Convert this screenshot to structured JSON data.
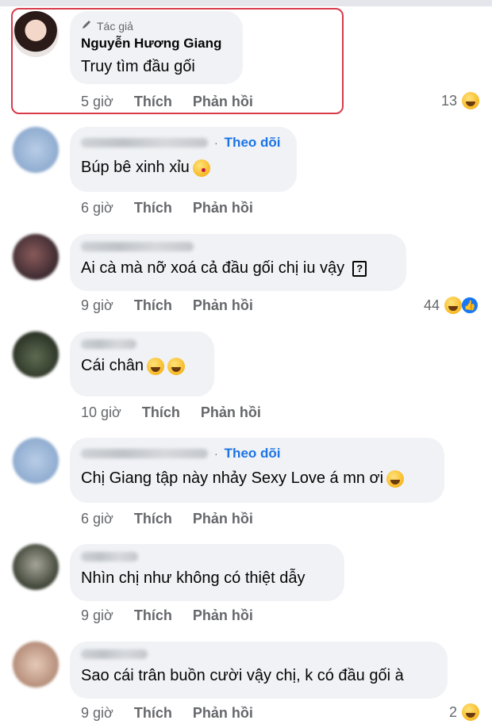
{
  "comments": [
    {
      "author_tag": "Tác giả",
      "name": "Nguyễn Hương Giang",
      "follow": "",
      "text": "Truy tìm đầu gối",
      "time": "5 giờ",
      "like": "Thích",
      "reply": "Phản hồi",
      "reaction_count": "13"
    },
    {
      "author_tag": "",
      "name": "",
      "follow": "Theo dõi",
      "text": "Búp bê xinh xỉu",
      "time": "6 giờ",
      "like": "Thích",
      "reply": "Phản hồi",
      "reaction_count": ""
    },
    {
      "author_tag": "",
      "name": "",
      "follow": "",
      "text": "Ai cà mà nỡ xoá cả đầu gối chị iu vậy",
      "time": "9 giờ",
      "like": "Thích",
      "reply": "Phản hồi",
      "reaction_count": "44"
    },
    {
      "author_tag": "",
      "name": "",
      "follow": "",
      "text": "Cái chân",
      "time": "10 giờ",
      "like": "Thích",
      "reply": "Phản hồi",
      "reaction_count": ""
    },
    {
      "author_tag": "",
      "name": "",
      "follow": "Theo dõi",
      "text": "Chị Giang tập này nhảy Sexy Love á mn ơi",
      "time": "6 giờ",
      "like": "Thích",
      "reply": "Phản hồi",
      "reaction_count": ""
    },
    {
      "author_tag": "",
      "name": "",
      "follow": "",
      "text": "Nhìn chị như không có thiệt dẫy",
      "time": "9 giờ",
      "like": "Thích",
      "reply": "Phản hồi",
      "reaction_count": ""
    },
    {
      "author_tag": "",
      "name": "",
      "follow": "",
      "text": "Sao cái trân buồn cười vậy chị, k có đầu gối à",
      "time": "9 giờ",
      "like": "Thích",
      "reply": "Phản hồi",
      "reaction_count": "2"
    }
  ],
  "icons": {
    "pencil": "pencil-icon",
    "haha": "haha-emoji-icon",
    "like": "like-reaction-icon",
    "kiss": "kissing-face-emoji-icon",
    "rofl": "rofl-emoji-icon",
    "laugh": "laughing-emoji-icon",
    "unknown_glyph": "?"
  },
  "colors": {
    "link_blue": "#1b74e4",
    "bubble_bg": "#f0f2f5",
    "secondary_text": "#65676b",
    "highlight_red": "#d93a4a"
  }
}
